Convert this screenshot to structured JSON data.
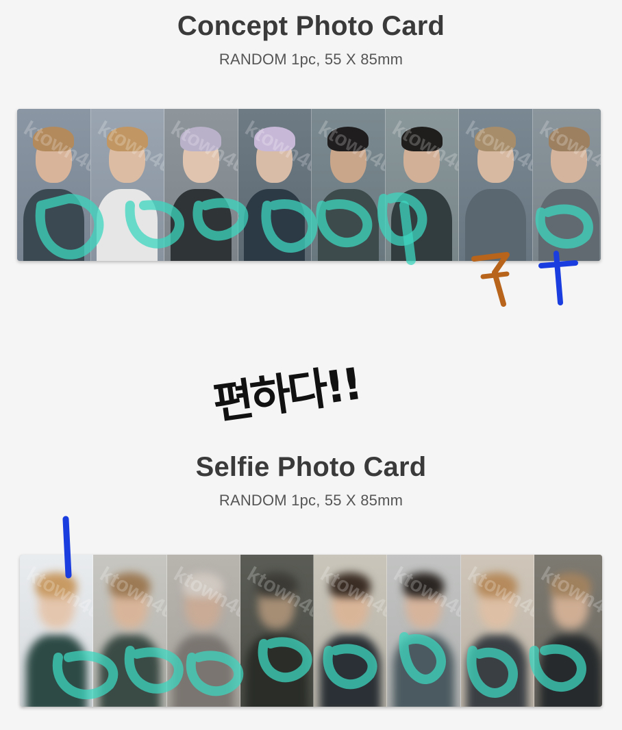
{
  "concept": {
    "title": "Concept Photo Card",
    "subtitle": "RANDOM 1pc, 55 X 85mm",
    "cards": [
      {
        "bg": "#8a96a3",
        "hair": "#b38a5c",
        "skin": "#d8b49a",
        "cloth": "#3b4a52"
      },
      {
        "bg": "#9aa5b1",
        "hair": "#c19662",
        "skin": "#dcbca2",
        "cloth": "#e6e6e6"
      },
      {
        "bg": "#8e969c",
        "hair": "#b9b0c9",
        "skin": "#e0c4b0",
        "cloth": "#2f3436"
      },
      {
        "bg": "#6e7a84",
        "hair": "#c8b8d8",
        "skin": "#d9bca8",
        "cloth": "#2c3a45"
      },
      {
        "bg": "#7b8a90",
        "hair": "#1f1d1d",
        "skin": "#c9a58a",
        "cloth": "#3e4b4c"
      },
      {
        "bg": "#8a979b",
        "hair": "#201d1d",
        "skin": "#d2b098",
        "cloth": "#323d40"
      },
      {
        "bg": "#7a8893",
        "hair": "#a88d6a",
        "skin": "#d7b8a0",
        "cloth": "#5a6670"
      },
      {
        "bg": "#8a959c",
        "hair": "#9d8060",
        "skin": "#d4b49c",
        "cloth": "#606a70"
      }
    ]
  },
  "handwritten": {
    "note": "편하다!!",
    "mark_seven": "7",
    "mark_plus": "+",
    "mark_one": "1"
  },
  "selfie": {
    "title": "Selfie Photo Card",
    "subtitle": "RANDOM 1pc, 55 X 85mm",
    "cards": [
      {
        "bg": "#e9ecef",
        "hair": "#c89a63",
        "skin": "#e4c6ae",
        "cloth": "#2d4a45"
      },
      {
        "bg": "#c7c6c0",
        "hair": "#9c7a55",
        "skin": "#d8b59a",
        "cloth": "#3a4a44"
      },
      {
        "bg": "#b8b4ae",
        "hair": "#d0c9c2",
        "skin": "#c9ab96",
        "cloth": "#7a7570"
      },
      {
        "bg": "#5a5c55",
        "hair": "#3b3a35",
        "skin": "#a68e75",
        "cloth": "#2a2d28"
      },
      {
        "bg": "#c9c5ba",
        "hair": "#3a2d24",
        "skin": "#d9b598",
        "cloth": "#2a3035"
      },
      {
        "bg": "#c2c3c2",
        "hair": "#2a2522",
        "skin": "#d6b49c",
        "cloth": "#4a5a60"
      },
      {
        "bg": "#cfc6b9",
        "hair": "#b58a5c",
        "skin": "#ddbfa5",
        "cloth": "#3a3f44"
      },
      {
        "bg": "#7d7a72",
        "hair": "#a0815e",
        "skin": "#cfae94",
        "cloth": "#262a2c"
      }
    ]
  },
  "watermark": "ktown4u"
}
